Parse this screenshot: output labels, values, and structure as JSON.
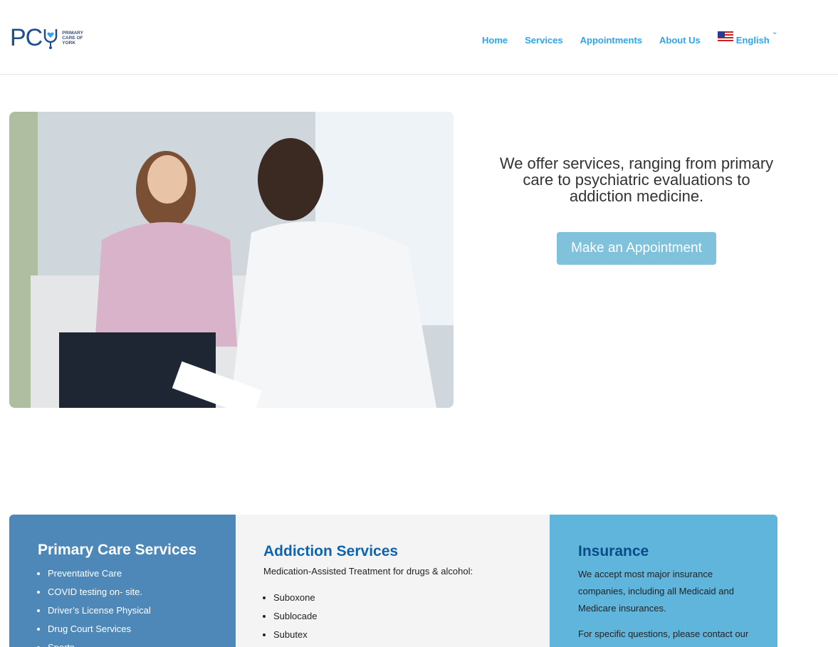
{
  "header": {
    "logo": {
      "letters": "PC",
      "words": "PRIMARY CARE OF YORK"
    },
    "nav": [
      "Home",
      "Services",
      "Appointments",
      "About Us"
    ],
    "language": "English",
    "accent": "#2ea3f2"
  },
  "hero": {
    "text": "We offer services, ranging from primary care to psychiatric evaluations to addiction medicine.",
    "cta": "Make an Appointment"
  },
  "cards": {
    "primary": {
      "title": "Primary Care Services",
      "items": [
        "Preventative Care",
        "COVID testing on- site.",
        "Driver’s License Physical",
        "Drug Court Services",
        "Sports ..."
      ]
    },
    "addiction": {
      "title": "Addiction Services",
      "intro": "Medication-Assisted Treatment for drugs & alcohol:",
      "items": [
        "Suboxone",
        "Sublocade",
        "Subutex"
      ]
    },
    "insurance": {
      "title": "Insurance",
      "text": "We accept most major insurance companies, including all Medicaid and Medicare insurances.",
      "text2": "For specific questions, please contact our"
    }
  }
}
